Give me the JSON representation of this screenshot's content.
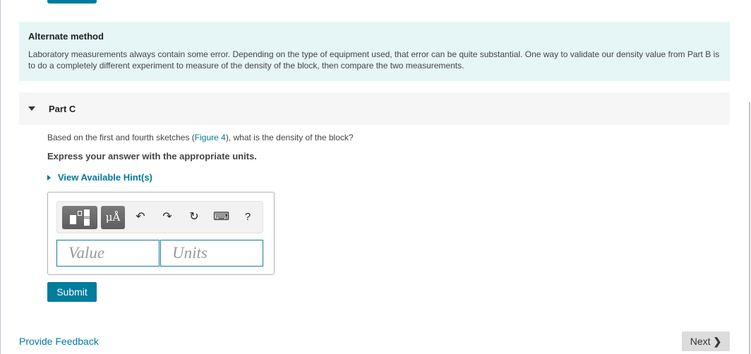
{
  "info": {
    "title": "Alternate method",
    "text": "Laboratory measurements always contain some error. Depending on the type of equipment used, that error can be quite substantial. One way to validate our density value from Part B is to do a completely different experiment to measure of the density of the block, then compare the two measurements."
  },
  "part": {
    "label": "Part C",
    "question_before": "Based on the first and fourth sketches (",
    "figure_link": "Figure 4",
    "question_after": "), what is the density of the block?",
    "express": "Express your answer with the appropriate units.",
    "hint_label": "View Available Hint(s)"
  },
  "toolbar": {
    "templates_icon": "templates-icon",
    "symbols_label": "μÅ",
    "undo_glyph": "↶",
    "redo_glyph": "↷",
    "reset_glyph": "↻",
    "keyboard_glyph": "⌨",
    "help_label": "?"
  },
  "inputs": {
    "value_placeholder": "Value",
    "units_placeholder": "Units"
  },
  "actions": {
    "submit_label": "Submit",
    "feedback_label": "Provide Feedback",
    "next_label": "Next",
    "next_chevron": "❯"
  },
  "colors": {
    "accent": "#007c9d",
    "info_bg": "#e6f5f6",
    "part_bg": "#f6f6f6"
  }
}
